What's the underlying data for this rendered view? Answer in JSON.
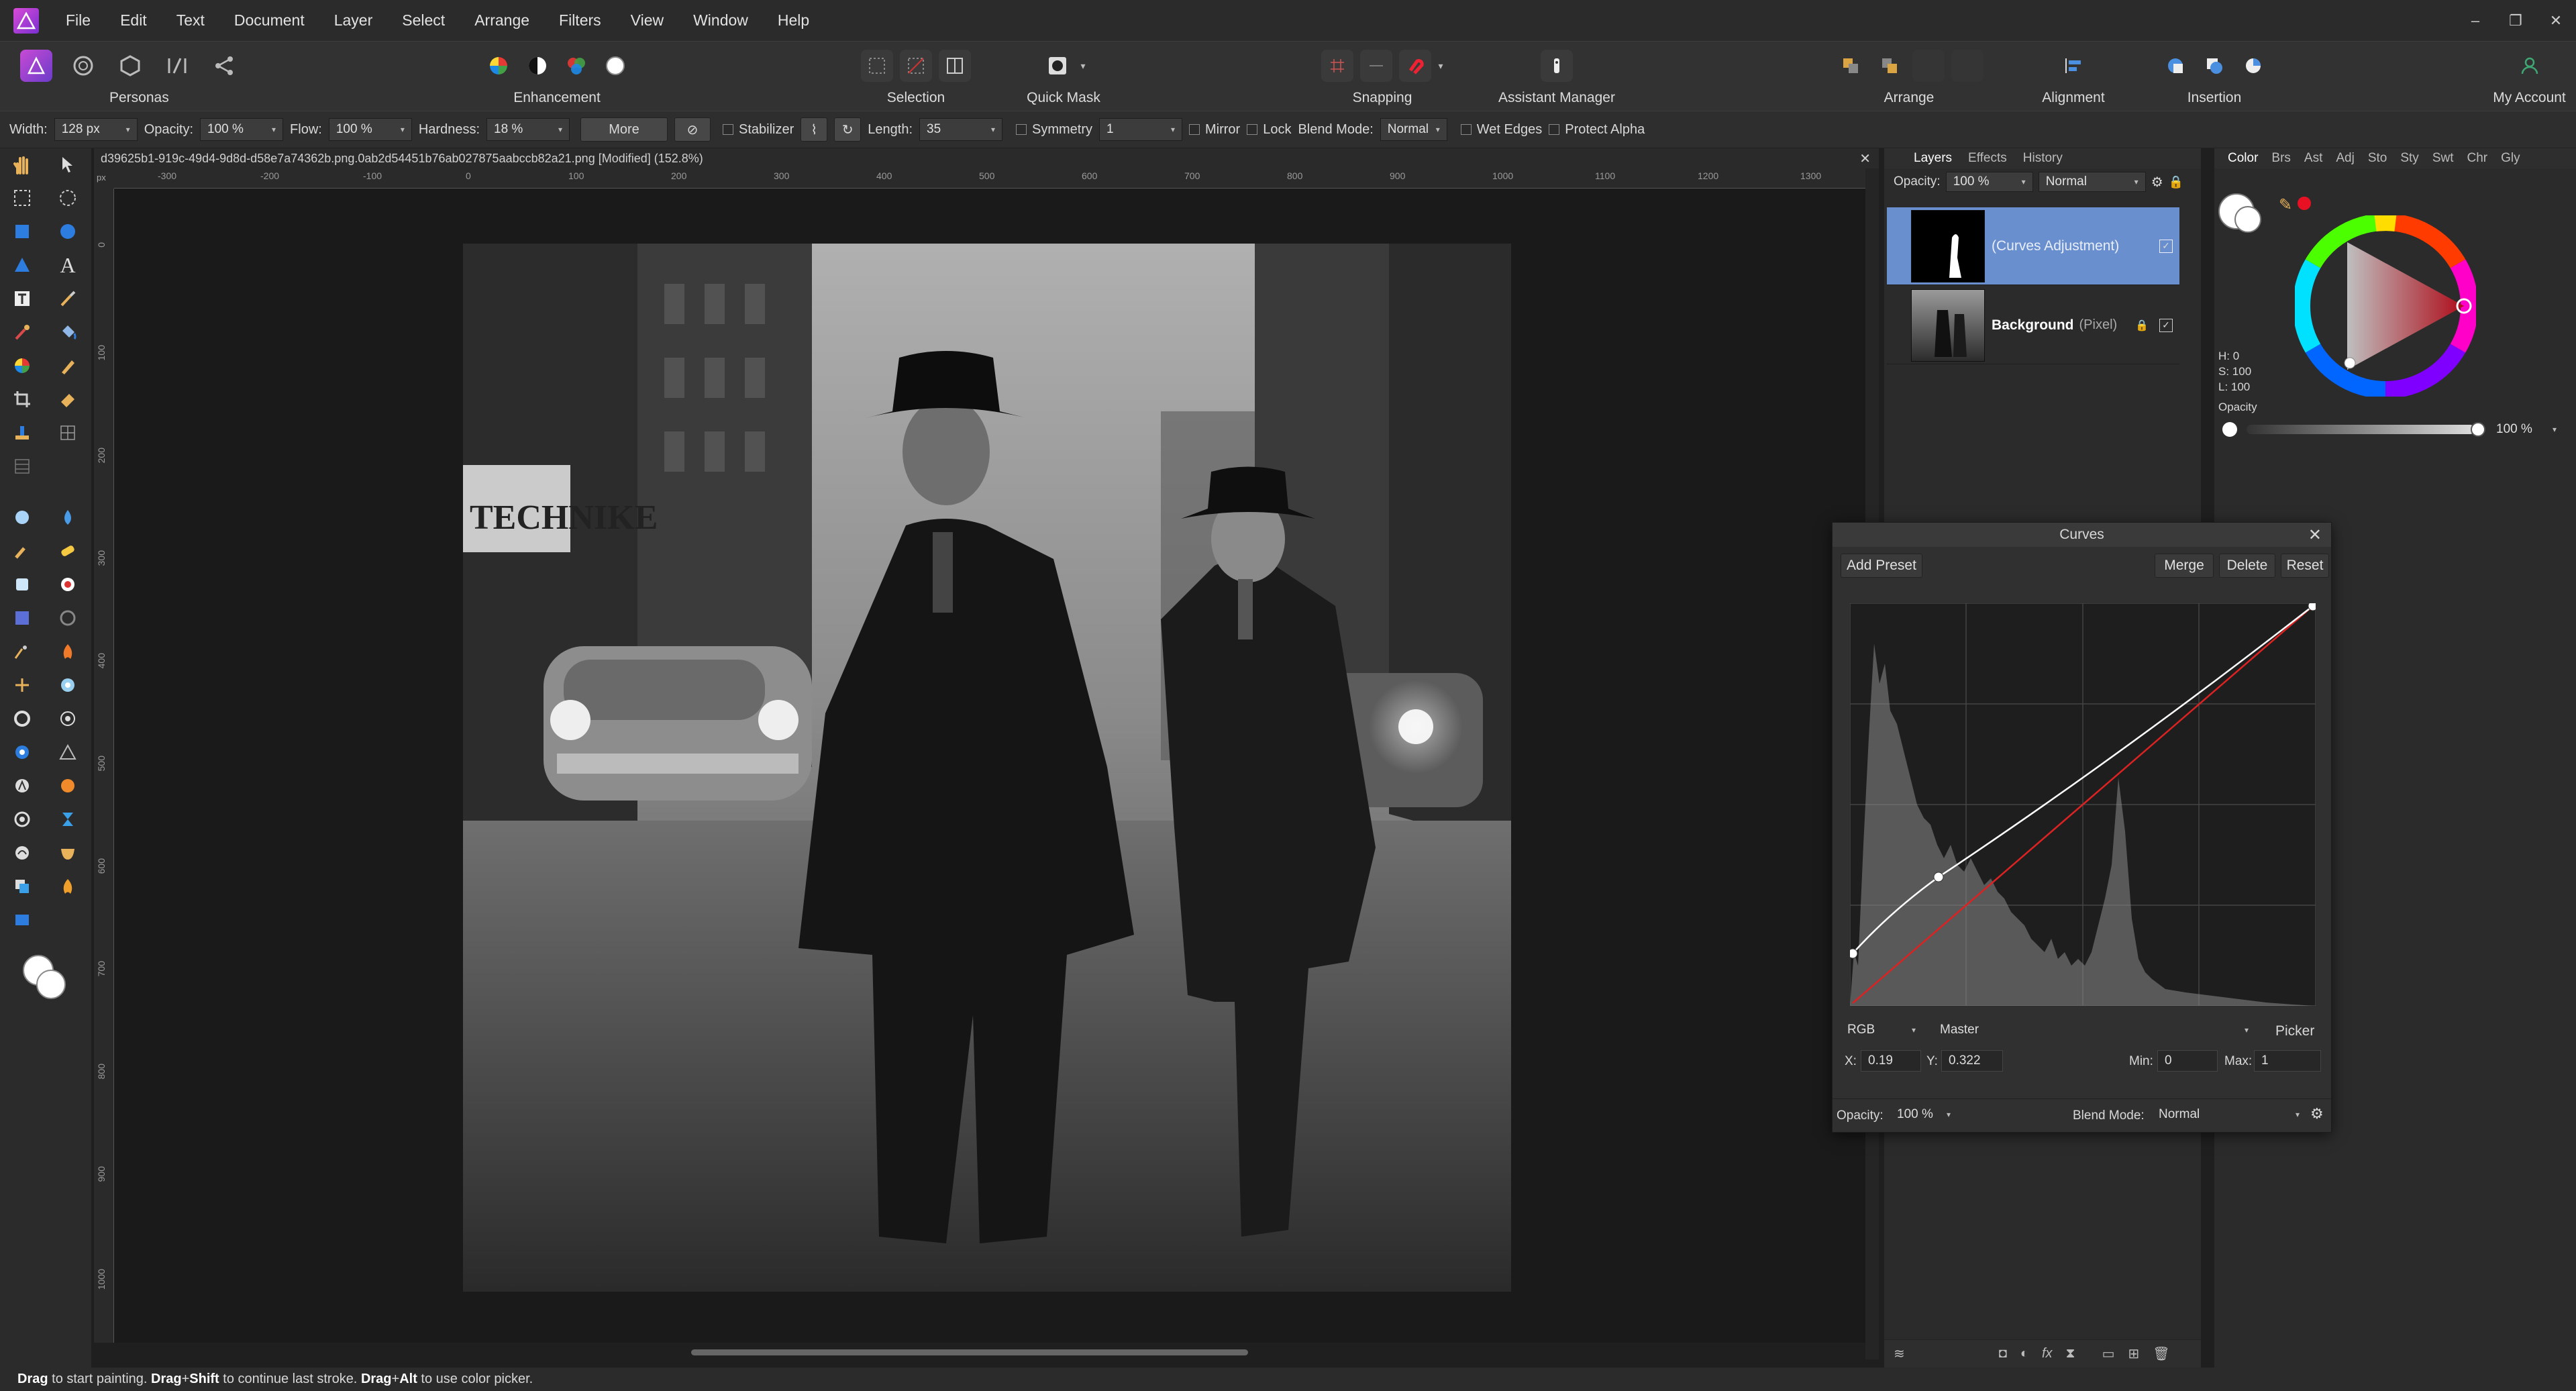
{
  "menubar": {
    "items": [
      "File",
      "Edit",
      "Text",
      "Document",
      "Layer",
      "Select",
      "Arrange",
      "Filters",
      "View",
      "Window",
      "Help"
    ],
    "window_controls": [
      "–",
      "❐",
      "✕"
    ]
  },
  "toolbar": {
    "personas": "Personas",
    "enhancement": "Enhancement",
    "selection": "Selection",
    "quick_mask": "Quick Mask",
    "snapping": "Snapping",
    "assistant": "Assistant Manager",
    "arrange": "Arrange",
    "alignment": "Alignment",
    "insertion": "Insertion",
    "account": "My Account"
  },
  "context": {
    "width_label": "Width:",
    "width_value": "128 px",
    "opacity_label": "Opacity:",
    "opacity_value": "100 %",
    "flow_label": "Flow:",
    "flow_value": "100 %",
    "hardness_label": "Hardness:",
    "hardness_value": "18 %",
    "more": "More",
    "stabilizer": "Stabilizer",
    "length_label": "Length:",
    "length_value": "35",
    "symmetry": "Symmetry",
    "symmetry_value": "1",
    "mirror": "Mirror",
    "lock": "Lock",
    "blend_label": "Blend Mode:",
    "blend_value": "Normal",
    "wet_edges": "Wet Edges",
    "protect_alpha": "Protect Alpha"
  },
  "document": {
    "tab_title": "d39625b1-919c-49d4-9d8d-d58e7a74362b.png.0ab2d54451b76ab027875aabccb82a21.png [Modified] (152.8%)",
    "close": "✕",
    "ruler_unit": "px",
    "ruler_h_ticks": [
      "-300",
      "-200",
      "-100",
      "0",
      "100",
      "200",
      "300",
      "400",
      "500",
      "600",
      "700",
      "800",
      "900",
      "1000",
      "1100",
      "1200",
      "1300"
    ],
    "ruler_v_ticks": [
      "0",
      "100",
      "200",
      "300",
      "400",
      "500",
      "600",
      "700",
      "800",
      "900",
      "1000"
    ],
    "sign_text": "TECHNIKE"
  },
  "layers": {
    "tabs": [
      "Layers",
      "Effects",
      "History"
    ],
    "opacity_label": "Opacity:",
    "opacity_value": "100 %",
    "blend_value": "Normal",
    "rows": [
      {
        "name": "(Curves Adjustment)",
        "type": ""
      },
      {
        "name": "Background",
        "type": "(Pixel)"
      }
    ]
  },
  "color": {
    "tabs": [
      "Color",
      "Brs",
      "Ast",
      "Adj",
      "Sto",
      "Sty",
      "Swt",
      "Chr",
      "Gly"
    ],
    "h": "H: 0",
    "s": "S: 100",
    "l": "L: 100",
    "opacity_label": "Opacity",
    "opacity_value": "100 %",
    "accent": "#e81123"
  },
  "curves": {
    "title": "Curves",
    "add_preset": "Add Preset",
    "merge": "Merge",
    "delete": "Delete",
    "reset": "Reset",
    "channel": "RGB",
    "mode": "Master",
    "picker": "Picker",
    "x_label": "X:",
    "x_value": "0.19",
    "y_label": "Y:",
    "y_value": "0.322",
    "min_label": "Min:",
    "min_value": "0",
    "max_label": "Max:",
    "max_value": "1",
    "opacity_label": "Opacity:",
    "opacity_value": "100 %",
    "blend_label": "Blend Mode:",
    "blend_value": "Normal"
  },
  "status": {
    "k1": "Drag",
    "t1": " to start painting. ",
    "k2": "Drag",
    "sep2": "+",
    "k2b": "Shift",
    "t2": " to continue last stroke. ",
    "k3": "Drag",
    "sep3": "+",
    "k3b": "Alt",
    "t3": " to use color picker."
  }
}
